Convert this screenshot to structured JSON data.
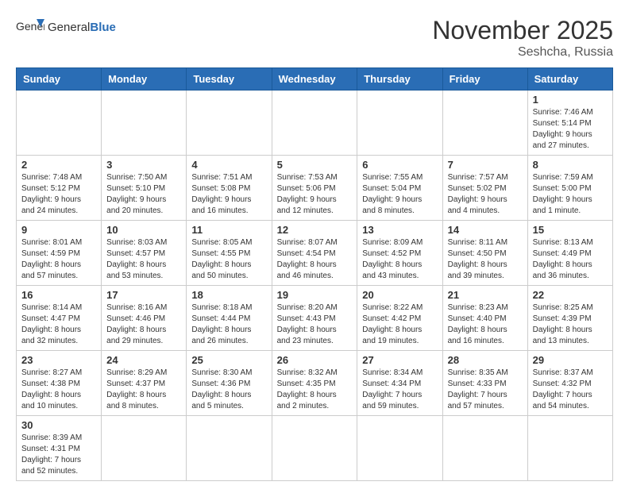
{
  "logo": {
    "text_general": "General",
    "text_blue": "Blue"
  },
  "header": {
    "month": "November 2025",
    "location": "Seshcha, Russia"
  },
  "weekdays": [
    "Sunday",
    "Monday",
    "Tuesday",
    "Wednesday",
    "Thursday",
    "Friday",
    "Saturday"
  ],
  "weeks": [
    [
      {
        "day": "",
        "info": ""
      },
      {
        "day": "",
        "info": ""
      },
      {
        "day": "",
        "info": ""
      },
      {
        "day": "",
        "info": ""
      },
      {
        "day": "",
        "info": ""
      },
      {
        "day": "",
        "info": ""
      },
      {
        "day": "1",
        "info": "Sunrise: 7:46 AM\nSunset: 5:14 PM\nDaylight: 9 hours\nand 27 minutes."
      }
    ],
    [
      {
        "day": "2",
        "info": "Sunrise: 7:48 AM\nSunset: 5:12 PM\nDaylight: 9 hours\nand 24 minutes."
      },
      {
        "day": "3",
        "info": "Sunrise: 7:50 AM\nSunset: 5:10 PM\nDaylight: 9 hours\nand 20 minutes."
      },
      {
        "day": "4",
        "info": "Sunrise: 7:51 AM\nSunset: 5:08 PM\nDaylight: 9 hours\nand 16 minutes."
      },
      {
        "day": "5",
        "info": "Sunrise: 7:53 AM\nSunset: 5:06 PM\nDaylight: 9 hours\nand 12 minutes."
      },
      {
        "day": "6",
        "info": "Sunrise: 7:55 AM\nSunset: 5:04 PM\nDaylight: 9 hours\nand 8 minutes."
      },
      {
        "day": "7",
        "info": "Sunrise: 7:57 AM\nSunset: 5:02 PM\nDaylight: 9 hours\nand 4 minutes."
      },
      {
        "day": "8",
        "info": "Sunrise: 7:59 AM\nSunset: 5:00 PM\nDaylight: 9 hours\nand 1 minute."
      }
    ],
    [
      {
        "day": "9",
        "info": "Sunrise: 8:01 AM\nSunset: 4:59 PM\nDaylight: 8 hours\nand 57 minutes."
      },
      {
        "day": "10",
        "info": "Sunrise: 8:03 AM\nSunset: 4:57 PM\nDaylight: 8 hours\nand 53 minutes."
      },
      {
        "day": "11",
        "info": "Sunrise: 8:05 AM\nSunset: 4:55 PM\nDaylight: 8 hours\nand 50 minutes."
      },
      {
        "day": "12",
        "info": "Sunrise: 8:07 AM\nSunset: 4:54 PM\nDaylight: 8 hours\nand 46 minutes."
      },
      {
        "day": "13",
        "info": "Sunrise: 8:09 AM\nSunset: 4:52 PM\nDaylight: 8 hours\nand 43 minutes."
      },
      {
        "day": "14",
        "info": "Sunrise: 8:11 AM\nSunset: 4:50 PM\nDaylight: 8 hours\nand 39 minutes."
      },
      {
        "day": "15",
        "info": "Sunrise: 8:13 AM\nSunset: 4:49 PM\nDaylight: 8 hours\nand 36 minutes."
      }
    ],
    [
      {
        "day": "16",
        "info": "Sunrise: 8:14 AM\nSunset: 4:47 PM\nDaylight: 8 hours\nand 32 minutes."
      },
      {
        "day": "17",
        "info": "Sunrise: 8:16 AM\nSunset: 4:46 PM\nDaylight: 8 hours\nand 29 minutes."
      },
      {
        "day": "18",
        "info": "Sunrise: 8:18 AM\nSunset: 4:44 PM\nDaylight: 8 hours\nand 26 minutes."
      },
      {
        "day": "19",
        "info": "Sunrise: 8:20 AM\nSunset: 4:43 PM\nDaylight: 8 hours\nand 23 minutes."
      },
      {
        "day": "20",
        "info": "Sunrise: 8:22 AM\nSunset: 4:42 PM\nDaylight: 8 hours\nand 19 minutes."
      },
      {
        "day": "21",
        "info": "Sunrise: 8:23 AM\nSunset: 4:40 PM\nDaylight: 8 hours\nand 16 minutes."
      },
      {
        "day": "22",
        "info": "Sunrise: 8:25 AM\nSunset: 4:39 PM\nDaylight: 8 hours\nand 13 minutes."
      }
    ],
    [
      {
        "day": "23",
        "info": "Sunrise: 8:27 AM\nSunset: 4:38 PM\nDaylight: 8 hours\nand 10 minutes."
      },
      {
        "day": "24",
        "info": "Sunrise: 8:29 AM\nSunset: 4:37 PM\nDaylight: 8 hours\nand 8 minutes."
      },
      {
        "day": "25",
        "info": "Sunrise: 8:30 AM\nSunset: 4:36 PM\nDaylight: 8 hours\nand 5 minutes."
      },
      {
        "day": "26",
        "info": "Sunrise: 8:32 AM\nSunset: 4:35 PM\nDaylight: 8 hours\nand 2 minutes."
      },
      {
        "day": "27",
        "info": "Sunrise: 8:34 AM\nSunset: 4:34 PM\nDaylight: 7 hours\nand 59 minutes."
      },
      {
        "day": "28",
        "info": "Sunrise: 8:35 AM\nSunset: 4:33 PM\nDaylight: 7 hours\nand 57 minutes."
      },
      {
        "day": "29",
        "info": "Sunrise: 8:37 AM\nSunset: 4:32 PM\nDaylight: 7 hours\nand 54 minutes."
      }
    ],
    [
      {
        "day": "30",
        "info": "Sunrise: 8:39 AM\nSunset: 4:31 PM\nDaylight: 7 hours\nand 52 minutes."
      },
      {
        "day": "",
        "info": ""
      },
      {
        "day": "",
        "info": ""
      },
      {
        "day": "",
        "info": ""
      },
      {
        "day": "",
        "info": ""
      },
      {
        "day": "",
        "info": ""
      },
      {
        "day": "",
        "info": ""
      }
    ]
  ]
}
